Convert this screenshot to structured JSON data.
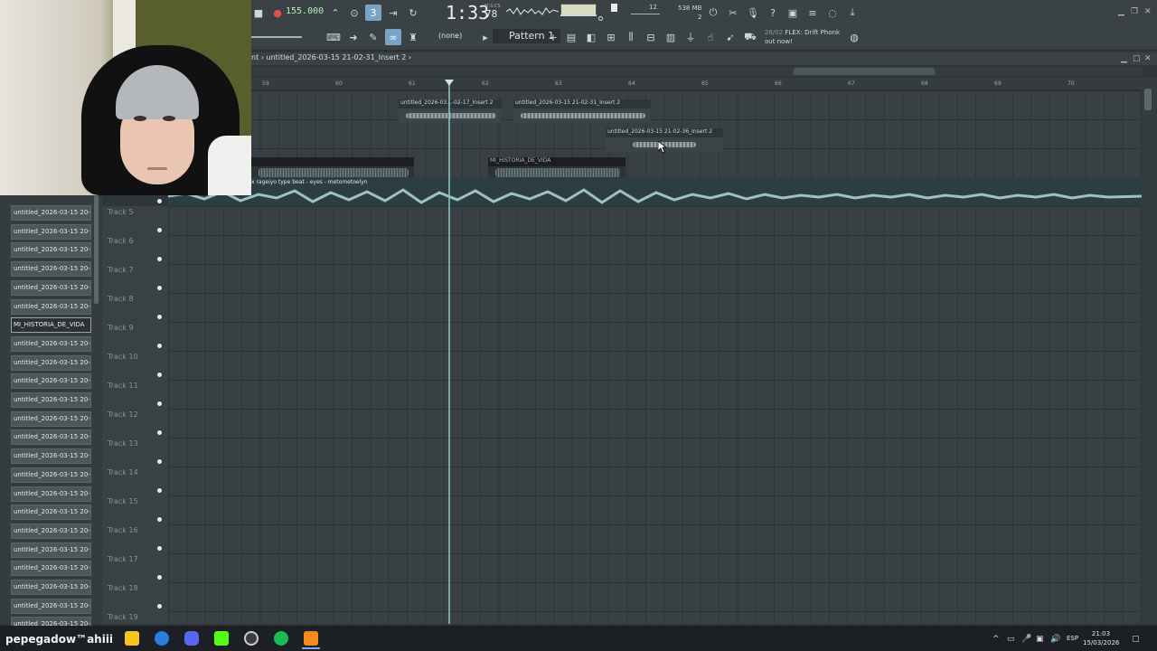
{
  "toolbar": {
    "tempo": "155.000",
    "time": "1:33",
    "time_sub": "78",
    "time_unit": "M:S:CS",
    "polyphony": "12",
    "polyphony_sub": "2",
    "memory": "538 MB",
    "memory_sub": "2",
    "snap": "(none)",
    "pattern": "Pattern 1",
    "news_date": "26/02",
    "news_text": "FLEX: Drift Phonk",
    "news_text2": "out now!"
  },
  "playlist": {
    "breadcrumb_prefix": "nt",
    "title": "untitled_2026-03-15 21-02-31_Insert 2",
    "ruler": [
      "59",
      "60",
      "61",
      "62",
      "63",
      "64",
      "65",
      "66",
      "67",
      "68",
      "69",
      "70"
    ]
  },
  "clips": [
    {
      "label": "untitled_2026-03...-02-17_Insert 2"
    },
    {
      "label": "untitled_2026-03-15 21-02-31_Insert 2"
    },
    {
      "label": "untitled_2026-03-15 21-02-36_Insert 2"
    },
    {
      "label": "MI_HISTORIA_DE_VIDA"
    }
  ],
  "audio_lane_label": "x rageiyo type beat - eyes - metometoelyn",
  "browser_items": [
    "untitled_2026-03-15 20-",
    "untitled_2026-03-15 20-",
    "untitled_2026-03-15 20-",
    "untitled_2026-03-15 20-",
    "untitled_2026-03-15 20-",
    "untitled_2026-03-15 20-",
    "MI_HISTORIA_DE_VIDA",
    "untitled_2026-03-15 20-",
    "untitled_2026-03-15 20-",
    "untitled_2026-03-15 20-",
    "untitled_2026-03-15 20-",
    "untitled_2026-03-15 20-",
    "untitled_2026-03-15 20-",
    "untitled_2026-03-15 20-",
    "untitled_2026-03-15 20-",
    "untitled_2026-03-15 20-",
    "untitled_2026-03-15 20-",
    "untitled_2026-03-15 20-",
    "untitled_2026-03-15 20-",
    "untitled_2026-03-15 20-",
    "untitled_2026-03-15 20-",
    "untitled_2026-03-15 20-",
    "untitled_2026-03-15 20-"
  ],
  "tracks": [
    "Track 5",
    "Track 6",
    "Track 7",
    "Track 8",
    "Track 9",
    "Track 10",
    "Track 11",
    "Track 12",
    "Track 13",
    "Track 14",
    "Track 15",
    "Track 16",
    "Track 17",
    "Track 18",
    "Track 19"
  ],
  "taskbar": {
    "user": "pepegadow™ahiii",
    "lang": "ESP",
    "time": "21:03",
    "date": "15/03/2026"
  },
  "colors": {
    "accent": "#7aa3c8",
    "audio_lane": "#2c3e42",
    "playhead": "#8ab7bd"
  }
}
